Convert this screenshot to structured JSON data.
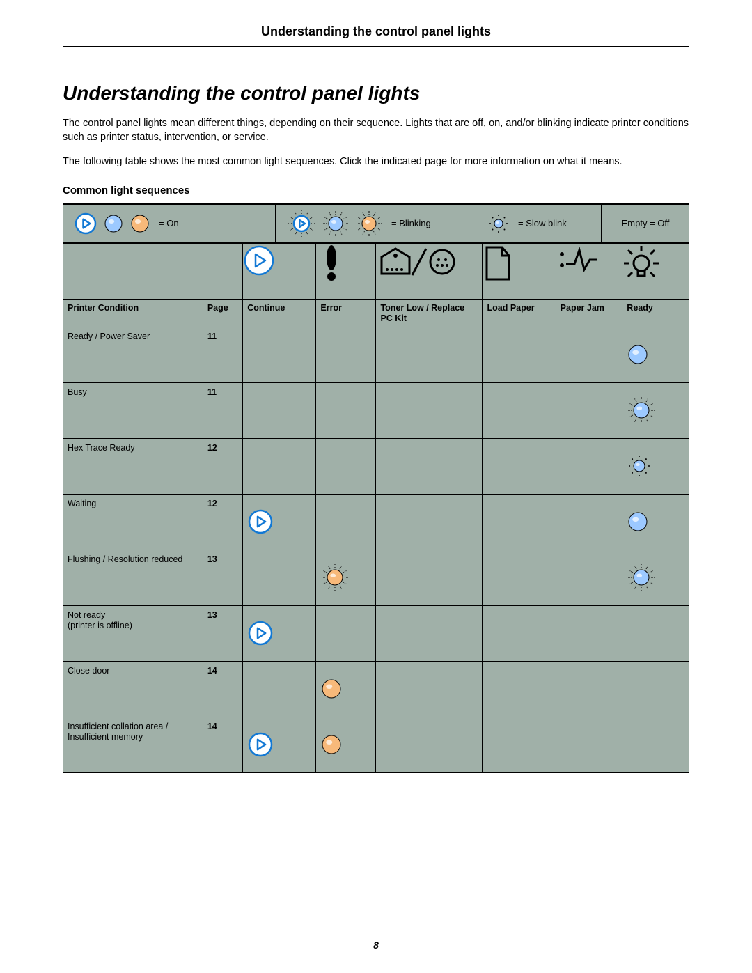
{
  "header": {
    "title": "Understanding the control panel lights"
  },
  "heading": "Understanding the control panel lights",
  "para1": "The control panel lights mean different things, depending on their sequence. Lights that are off, on, and/or blinking indicate printer conditions such as printer status, intervention, or service.",
  "para2": "The following table shows the most common light sequences. Click the indicated page for more information on what it means.",
  "subheading": "Common light sequences",
  "legend": {
    "on": "= On",
    "blinking": "= Blinking",
    "slowblink": "= Slow blink",
    "off": "Empty = Off"
  },
  "columns": {
    "condition": "Printer Condition",
    "page": "Page",
    "continue": "Continue",
    "error": "Error",
    "toner": "Toner Low / Replace PC Kit",
    "loadpaper": "Load Paper",
    "paperjam": "Paper Jam",
    "ready": "Ready"
  },
  "rows": [
    {
      "condition": "Ready / Power Saver",
      "page": "11",
      "continue": "",
      "error": "",
      "toner": "",
      "loadpaper": "",
      "paperjam": "",
      "ready": "on-blue"
    },
    {
      "condition": "Busy",
      "page": "11",
      "continue": "",
      "error": "",
      "toner": "",
      "loadpaper": "",
      "paperjam": "",
      "ready": "blink-blue"
    },
    {
      "condition": "Hex Trace Ready",
      "page": "12",
      "continue": "",
      "error": "",
      "toner": "",
      "loadpaper": "",
      "paperjam": "",
      "ready": "slow-blue"
    },
    {
      "condition": "Waiting",
      "page": "12",
      "continue": "on-continue",
      "error": "",
      "toner": "",
      "loadpaper": "",
      "paperjam": "",
      "ready": "on-blue"
    },
    {
      "condition": "Flushing / Resolution reduced",
      "page": "13",
      "continue": "",
      "error": "blink-orange",
      "toner": "",
      "loadpaper": "",
      "paperjam": "",
      "ready": "blink-blue"
    },
    {
      "condition": "Not ready\n(printer is offline)",
      "page": "13",
      "continue": "on-continue",
      "error": "",
      "toner": "",
      "loadpaper": "",
      "paperjam": "",
      "ready": ""
    },
    {
      "condition": "Close door",
      "page": "14",
      "continue": "",
      "error": "on-orange",
      "toner": "",
      "loadpaper": "",
      "paperjam": "",
      "ready": ""
    },
    {
      "condition": "Insufficient collation area / Insufficient memory",
      "page": "14",
      "continue": "on-continue",
      "error": "on-orange",
      "toner": "",
      "loadpaper": "",
      "paperjam": "",
      "ready": ""
    }
  ],
  "footer": {
    "page_number": "8"
  }
}
